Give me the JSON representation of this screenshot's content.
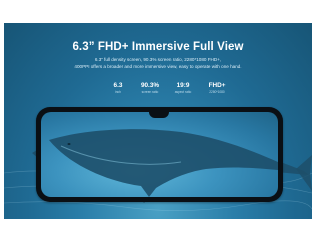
{
  "banner": {
    "title": "6.3” FHD+ Immersive Full View",
    "description_line1": "6.3” full density screen, 90.3% screen ratio, 2280*1080 FHD+,",
    "description_line2": "400PPI offers a broader and more immersive view, easy to operate with one hand."
  },
  "specs": [
    {
      "value": "6.3",
      "label": "inch"
    },
    {
      "value": "90.3%",
      "label": "screen ratio"
    },
    {
      "value": "19:9",
      "label": "aspect ratio"
    },
    {
      "value": "FHD+",
      "label": "2280*1080"
    }
  ],
  "colors": {
    "ocean_dark": "#175576",
    "ocean_light": "#4aa0c4",
    "phone_bezel": "#0a0f14",
    "whale": "#1d4f6a"
  }
}
